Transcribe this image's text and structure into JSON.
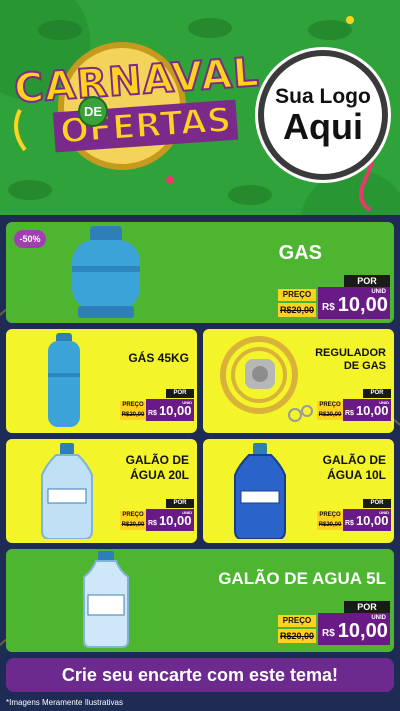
{
  "header": {
    "title_line1": "CARNAVAL",
    "title_de": "DE",
    "title_line2": "OFERTAS",
    "logo_line1": "Sua Logo",
    "logo_line2": "Aqui"
  },
  "products": [
    {
      "name": "GAS",
      "badge": "-50%",
      "por": "POR",
      "preco": "PREÇO",
      "old": "R$20,00",
      "currency": "R$",
      "price": "10,00",
      "unit": "UNID"
    },
    {
      "name": "GÁS 45KG",
      "por": "POR",
      "preco": "PREÇO",
      "old": "R$20,00",
      "currency": "R$",
      "price": "10,00",
      "unit": "UNID"
    },
    {
      "name": "REGULADOR DE GAS",
      "por": "POR",
      "preco": "PREÇO",
      "old": "R$20,00",
      "currency": "R$",
      "price": "10,00",
      "unit": "UNID"
    },
    {
      "name": "GALÃO DE ÁGUA 20L",
      "por": "POR",
      "preco": "PREÇO",
      "old": "R$20,00",
      "currency": "R$",
      "price": "10,00",
      "unit": "UNID"
    },
    {
      "name": "GALÃO DE ÁGUA 10L",
      "por": "POR",
      "preco": "PREÇO",
      "old": "R$20,00",
      "currency": "R$",
      "price": "10,00",
      "unit": "UNID"
    },
    {
      "name": "GALÃO DE AGUA 5L",
      "por": "POR",
      "preco": "PREÇO",
      "old": "R$20,00",
      "currency": "R$",
      "price": "10,00",
      "unit": "UNID"
    }
  ],
  "footer": {
    "cta": "Crie seu encarte com este tema!",
    "disclaimer": "*Imagens Meramente Ilustrativas"
  },
  "colors": {
    "green": "#4eb531",
    "yellow": "#f4f42b",
    "purple": "#6a1a86",
    "navy": "#1d2b55",
    "gold": "#ffd21f"
  }
}
